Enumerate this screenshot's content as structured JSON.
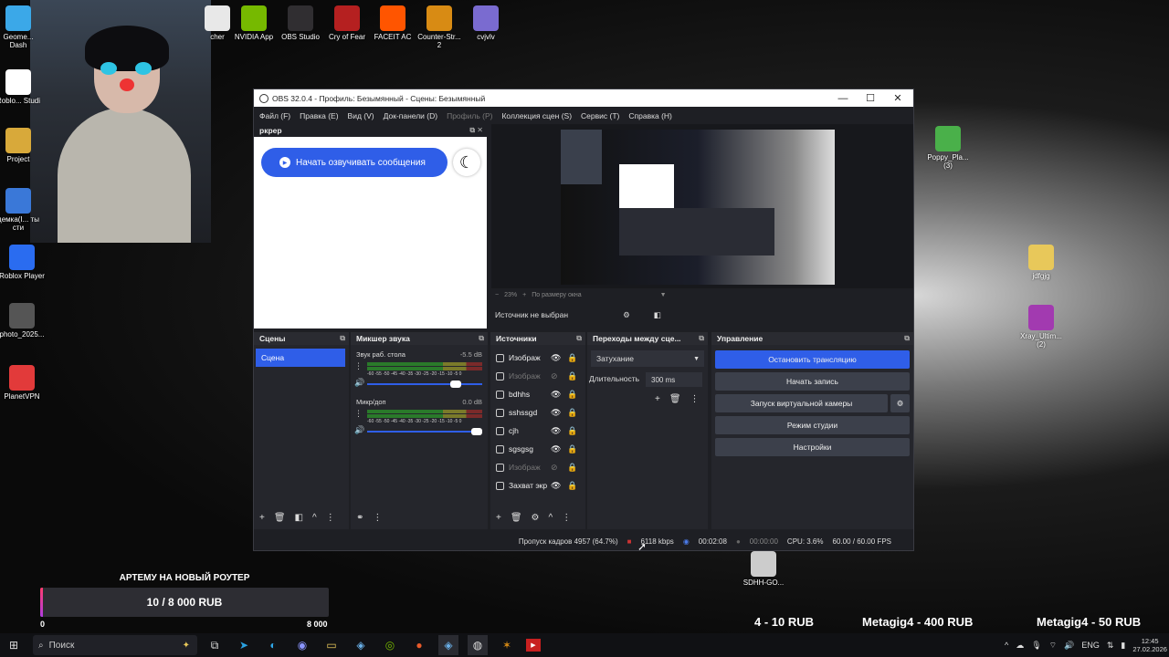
{
  "desktop": {
    "top_icons": [
      {
        "label": "cher",
        "color": "#e8e8e8"
      },
      {
        "label": "NVIDIA App",
        "color": "#76b900"
      },
      {
        "label": "OBS Studio",
        "color": "#302e31"
      },
      {
        "label": "Cry of Fear",
        "color": "#b52020"
      },
      {
        "label": "FACEIT AC",
        "color": "#ff5500"
      },
      {
        "label": "Counter-Str... 2",
        "color": "#d88b14"
      },
      {
        "label": "cvjvlv",
        "color": "#7a6bd0"
      }
    ],
    "left_icons": [
      {
        "label": "Geome... Dash",
        "color": "#3ba8e8"
      },
      {
        "label": "Roblo... Studi",
        "color": "#ffffff"
      },
      {
        "label": "Project",
        "color": "#d8a93a"
      },
      {
        "label": "демка(I... ты сти",
        "color": "#3a78d8"
      },
      {
        "label": "Roblox Player",
        "color": "#2a6cf0"
      },
      {
        "label": "photo_2025...",
        "color": "#555555"
      },
      {
        "label": "PlanetVPN",
        "color": "#e23a3a"
      }
    ],
    "right_icons": [
      {
        "label": "Poppy_Pla... (3)",
        "color": "#4ab04a"
      },
      {
        "label": "jdfgjg",
        "color": "#e8c85a"
      },
      {
        "label": "Xray_Ultim... (2)",
        "color": "#a23ab0"
      },
      {
        "label": "SDHH-GO...",
        "color": "#cccccc"
      }
    ]
  },
  "obs": {
    "title": "OBS 32.0.4 - Профиль: Безымянный - Сцены: Безымянный",
    "menu": [
      "Файл (F)",
      "Правка (E)",
      "Вид (V)",
      "Док-панели (D)",
      "Профиль (P)",
      "Коллекция сцен (S)",
      "Сервис (T)",
      "Справка (H)"
    ],
    "browser_dock": {
      "title": "ркрер",
      "speak_button": "Начать озвучивать сообщения"
    },
    "zoom": {
      "level": "23%",
      "fit": "По размеру окна"
    },
    "no_source": "Источник не выбран",
    "scenes": {
      "title": "Сцены",
      "items": [
        "Сцена"
      ]
    },
    "mixer": {
      "title": "Микшер звука",
      "channels": [
        {
          "name": "Звук раб. стола",
          "db": "-5.5 dB",
          "scale": "-60 -55 -50 -45 -40 -35 -30 -25 -20 -15 -10 -5 0",
          "volume": 0.82
        },
        {
          "name": "Микр/доп",
          "db": "0.0 dB",
          "scale": "-60 -55 -50 -45 -40 -35 -30 -25 -20 -15 -10 -5 0",
          "volume": 1.0
        }
      ]
    },
    "sources": {
      "title": "Источники",
      "items": [
        {
          "name": "Изображ",
          "visible": true
        },
        {
          "name": "Изображ",
          "visible": false
        },
        {
          "name": "bdhhs",
          "visible": true
        },
        {
          "name": "sshssgd",
          "visible": true
        },
        {
          "name": "cjh",
          "visible": true
        },
        {
          "name": "sgsgsg",
          "visible": true
        },
        {
          "name": "Изображ",
          "visible": false
        },
        {
          "name": "Захват экр",
          "visible": true
        }
      ]
    },
    "transitions": {
      "title": "Переходы между сце...",
      "type": "Затухание",
      "duration_label": "Длительность",
      "duration": "300 ms"
    },
    "controls": {
      "title": "Управление",
      "stop_stream": "Остановить трансляцию",
      "start_record": "Начать запись",
      "virtual_cam": "Запуск виртуальной камеры",
      "studio_mode": "Режим студии",
      "settings": "Настройки"
    },
    "status": {
      "dropped": "Пропуск кадров 4957 (64.7%)",
      "bitrate": "6118 kbps",
      "stream_time": "00:02:08",
      "rec_time": "00:00:00",
      "cpu": "CPU: 3.6%",
      "fps": "60.00 / 60.00 FPS"
    }
  },
  "donation": {
    "goal_title": "АРТЕМУ НА НОВЫЙ РОУТЕР",
    "progress_text": "10 / 8 000 RUB",
    "min": "0",
    "max": "8 000",
    "progress": 0.00125,
    "ticker": [
      "4 - 10 RUB",
      "Metagig4 - 400 RUB",
      "Metagig4 - 50 RUB"
    ]
  },
  "taskbar": {
    "search_placeholder": "Поиск",
    "lang": "ENG",
    "time": "12:45",
    "date": "27.02.2026"
  }
}
